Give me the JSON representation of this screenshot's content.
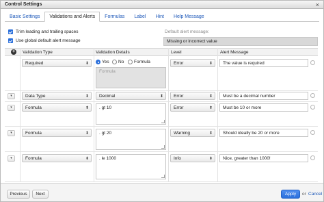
{
  "window": {
    "title": "Control Settings"
  },
  "tabs": [
    {
      "label": "Basic Settings"
    },
    {
      "label": "Validations and Alerts"
    },
    {
      "label": "Formulas"
    },
    {
      "label": "Label"
    },
    {
      "label": "Hint"
    },
    {
      "label": "Help Message"
    }
  ],
  "options": {
    "trim_label": "Trim leading and trailing spaces",
    "use_global_label": "Use global default alert message",
    "default_alert_label": "Default alert message:",
    "default_alert_value": "Missing or incorrect value"
  },
  "table": {
    "headers": [
      "Validation Type",
      "Validation Details",
      "Level",
      "Alert Message"
    ],
    "required_row": {
      "type": "Required",
      "radio_yes": "Yes",
      "radio_no": "No",
      "radio_formula": "Formula",
      "selected_radio": "Yes",
      "formula_placeholder": "Formula",
      "level": "Error",
      "message": "The value is required"
    },
    "rows": [
      {
        "type": "Data Type",
        "detail": "Decimal",
        "level": "Error",
        "message": "Must be a decimal number"
      },
      {
        "type": "Formula",
        "detail": ". gt 10",
        "level": "Error",
        "message": "Must be 10 or more"
      },
      {
        "type": "Formula",
        "detail": ". gt 20",
        "level": "Warning",
        "message": "Should ideally be 20 or more"
      },
      {
        "type": "Formula",
        "detail": ". le 1000",
        "level": "Info",
        "message": "Nice, greater than 1000!"
      }
    ]
  },
  "footer": {
    "previous_label": "Previous",
    "next_label": "Next",
    "apply_label": "Apply",
    "or_label": "or",
    "cancel_label": "Cancel"
  },
  "colors": {
    "accent": "#2a6fdb",
    "link": "#1a56b8",
    "disabled_field": "#d8d8d8"
  }
}
